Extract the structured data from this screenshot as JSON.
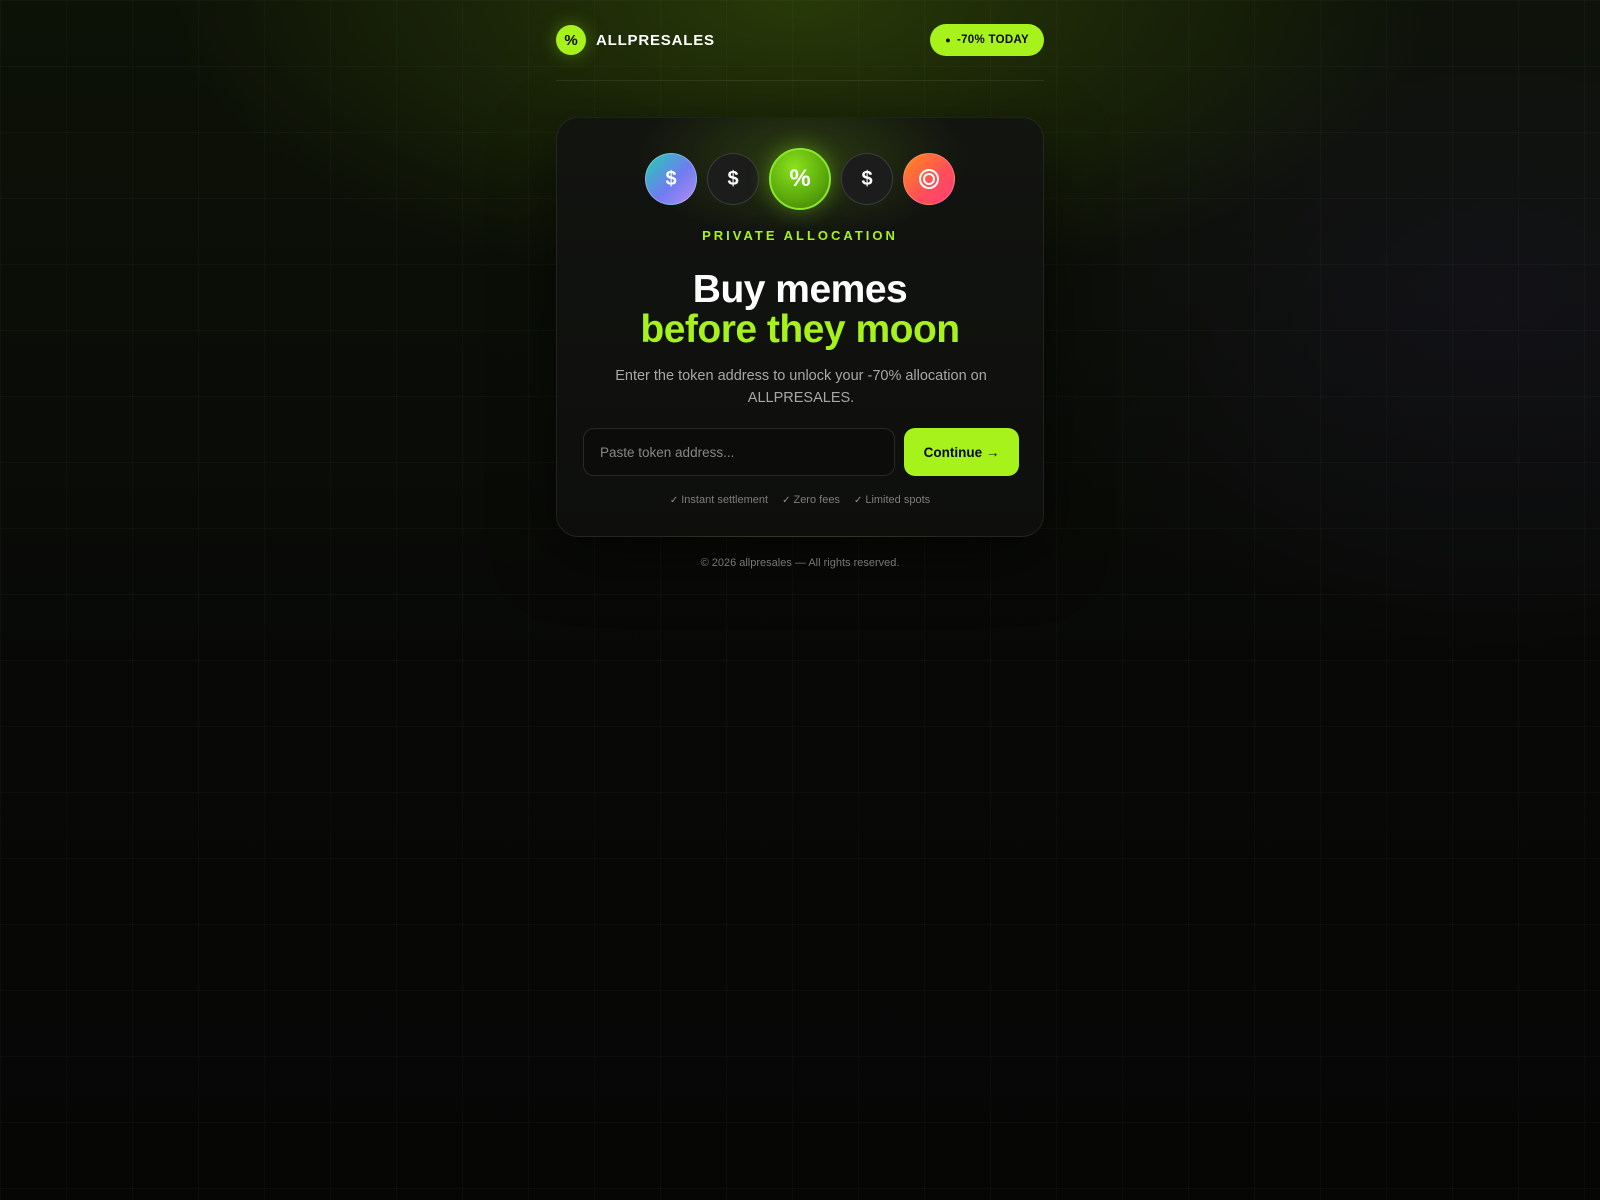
{
  "brand": {
    "logo_glyph": "%",
    "name": "ALLPRESALES"
  },
  "header": {
    "badge_dot": "●",
    "badge_label": "-70% TODAY"
  },
  "card": {
    "coins": [
      {
        "glyph": "$",
        "icon": "dollar-coin-icon"
      },
      {
        "glyph": "$",
        "icon": "dollar-coin-icon"
      },
      {
        "glyph": "%",
        "icon": "percent-coin-icon"
      },
      {
        "glyph": "$",
        "icon": "dollar-coin-icon"
      },
      {
        "glyph": "",
        "icon": "ring-coin-icon"
      }
    ],
    "eyebrow": "PRIVATE ALLOCATION",
    "headline_line1": "Buy memes",
    "headline_line2": "before they moon",
    "subtext": "Enter the token address to unlock your -70% allocation on ALLPRESALES.",
    "input_placeholder": "Paste token address...",
    "input_value": "",
    "continue_label": "Continue →",
    "features": [
      {
        "check": "✓",
        "label": "Instant settlement"
      },
      {
        "check": "✓",
        "label": "Zero fees"
      },
      {
        "check": "✓",
        "label": "Limited spots"
      }
    ]
  },
  "footer": {
    "text": "© 2026 allpresales — All rights reserved."
  },
  "colors": {
    "accent": "#a6f21a",
    "background": "#070806",
    "card": "#0e0f0d"
  }
}
